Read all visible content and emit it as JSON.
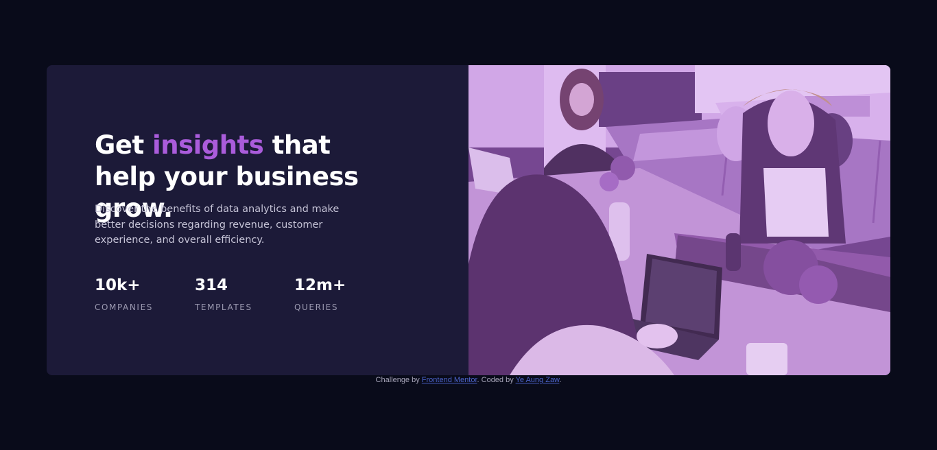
{
  "card": {
    "headline": {
      "before": "Get ",
      "accent": "insights",
      "after": " that help your business grow."
    },
    "description": "Discover the benefits of data analytics and make better decisions regarding revenue, customer experience, and overall efficiency.",
    "stats": [
      {
        "value": "10k+",
        "label": "COMPANIES"
      },
      {
        "value": "314",
        "label": "TEMPLATES"
      },
      {
        "value": "12m+",
        "label": "QUERIES"
      }
    ],
    "image": {
      "icon": "office-team-photo"
    }
  },
  "attribution": {
    "prefix": "Challenge by ",
    "link1": "Frontend Mentor",
    "middle": ". Coded by ",
    "link2": "Ye Aung Zaw",
    "suffix": "."
  },
  "colors": {
    "page_bg": "#090b1a",
    "card_bg": "#1c1a38",
    "accent": "#aa5cdb",
    "image_tint": "#aa5cdb"
  }
}
